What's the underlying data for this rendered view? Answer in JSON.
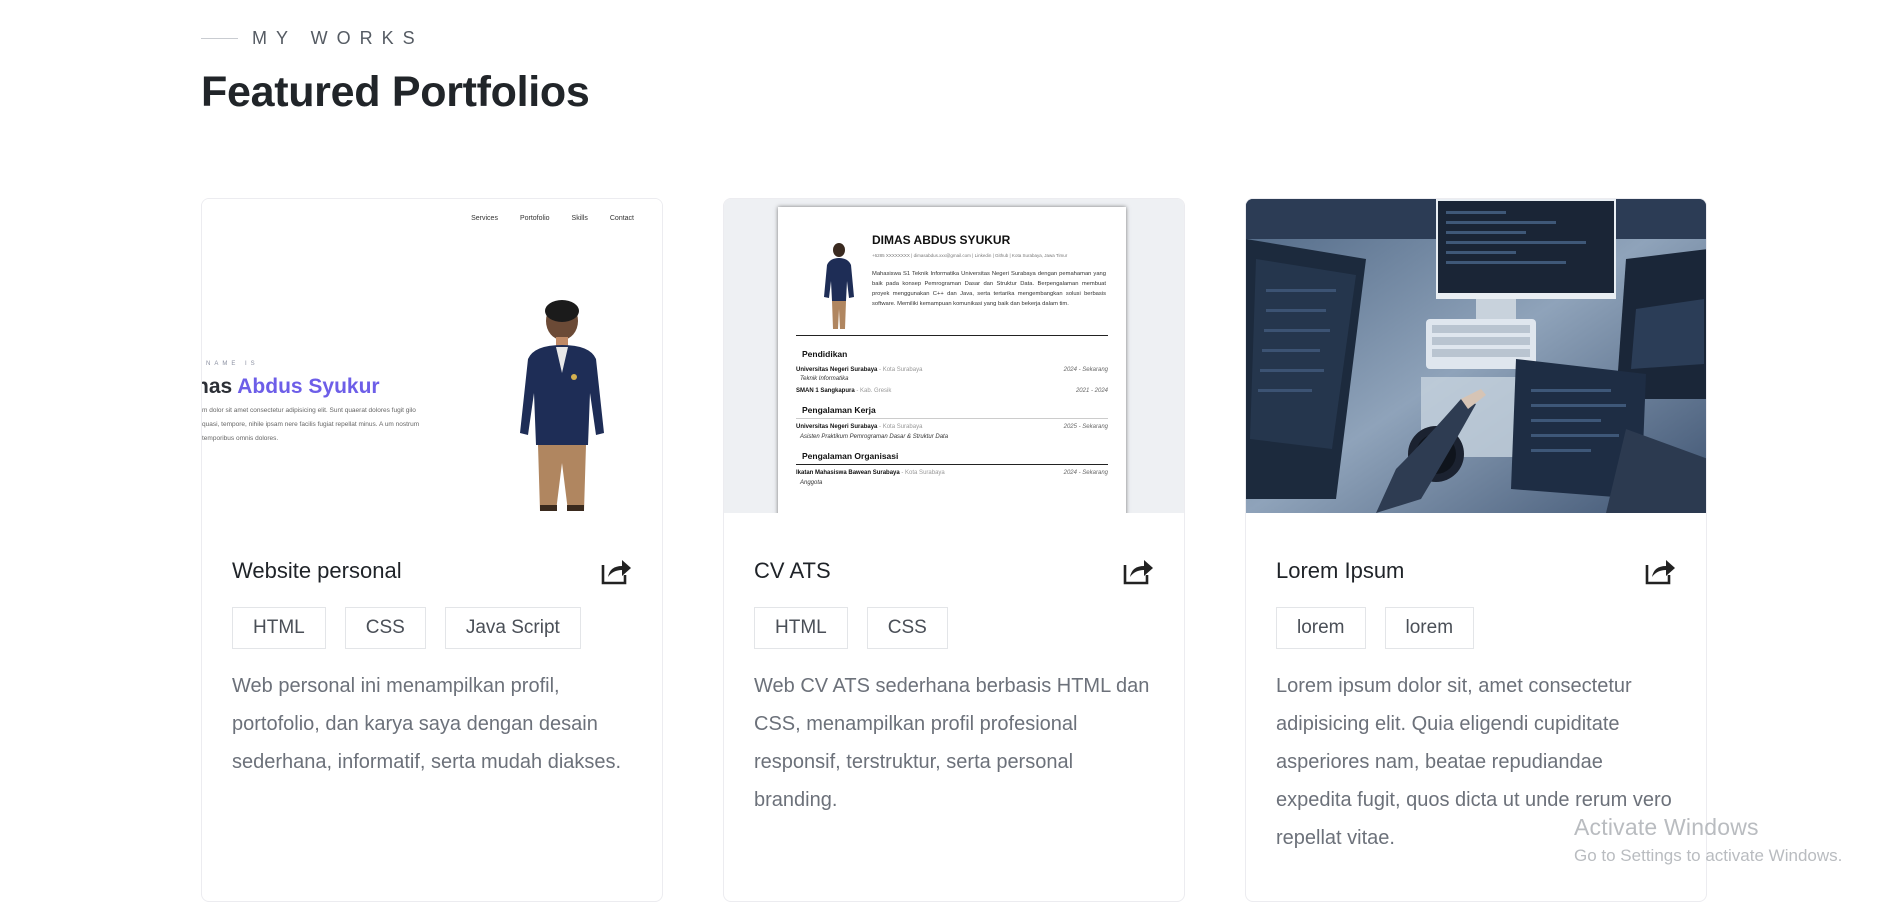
{
  "section": {
    "eyebrow": "MY WORKS",
    "title": "Featured Portfolios"
  },
  "cards": [
    {
      "title": "Website personal",
      "tags": [
        "HTML",
        "CSS",
        "Java Script"
      ],
      "description": "Web personal ini menampilkan profil, portofolio, dan karya saya dengan desain sederhana, informatif, serta mudah diakses.",
      "preview": {
        "nav": [
          "Services",
          "Portofolio",
          "Skills",
          "Contact"
        ],
        "hello": "NAME IS",
        "name_plain": "nas ",
        "name_highlight": "Abdus Syukur",
        "blurb": "m dolor sit amet consectetur adipisicing elit. Sunt quaerat dolores fugit gilo quasi, tempore, nihile ipsam nere facilis fugiat repellat minus. A um nostrum temporibus omnis dolores."
      }
    },
    {
      "title": "CV ATS",
      "tags": [
        "HTML",
        "CSS"
      ],
      "description": "Web CV ATS sederhana berbasis HTML dan CSS, menampilkan profil profesional responsif, terstruktur, serta personal branding.",
      "preview": {
        "name": "DIMAS ABDUS SYUKUR",
        "contact": "+6285 XXXXXXXX | dimasabdus.xxx@gmail.com | Linkedin | Github | Kota Surabaya, Jawa Timur",
        "summary": "Mahasiswa S1 Teknik Informatika Universitas Negeri Surabaya dengan pemahaman yang baik pada konsep Pemrograman Dasar dan Struktur Data. Berpengalaman membuat proyek menggunakan C++ dan Java, serta tertarika mengembangkan solusi berbasis software. Memiliki kemampuan komunikasi yang baik dan bekerja dalam tim.",
        "sections": {
          "education_heading": "Pendidikan",
          "work_heading": "Pengalaman Kerja",
          "org_heading": "Pengalaman Organisasi"
        },
        "education": [
          {
            "school": "Universitas Negeri Surabaya",
            "loc": " - Kota Surabaya",
            "date": "2024 - Sekarang",
            "sub": "Teknik Informatika"
          },
          {
            "school": "SMAN 1 Sangkapura",
            "loc": " - Kab. Gresik",
            "date": "2021 - 2024"
          }
        ],
        "work": [
          {
            "school": "Universitas Negeri Surabaya",
            "loc": " - Kota Surabaya",
            "date": "2025 - Sekarang",
            "sub": "Asisten Praktikum Pemrograman Dasar & Struktur Data"
          }
        ],
        "org": [
          {
            "school": "Ikatan Mahasiswa Bawean Surabaya",
            "loc": " - Kota Surabaya",
            "date": "2024 - Sekarang",
            "sub": "Anggota"
          }
        ]
      }
    },
    {
      "title": "Lorem Ipsum",
      "tags": [
        "lorem",
        "lorem"
      ],
      "description": "Lorem ipsum dolor sit, amet consectetur adipisicing elit. Quia eligendi cupiditate asperiores nam, beatae repudiandae expedita fugit, quos dicta ut unde rerum vero repellat vitae."
    }
  ],
  "watermark": {
    "title": "Activate Windows",
    "subtitle": "Go to Settings to activate Windows."
  },
  "colors": {
    "accent": "#6d5ee8",
    "heading": "#212529",
    "body_text": "#6c717a",
    "tag_border": "#e3e5e8"
  },
  "icons": {
    "share": "share-external-icon"
  }
}
